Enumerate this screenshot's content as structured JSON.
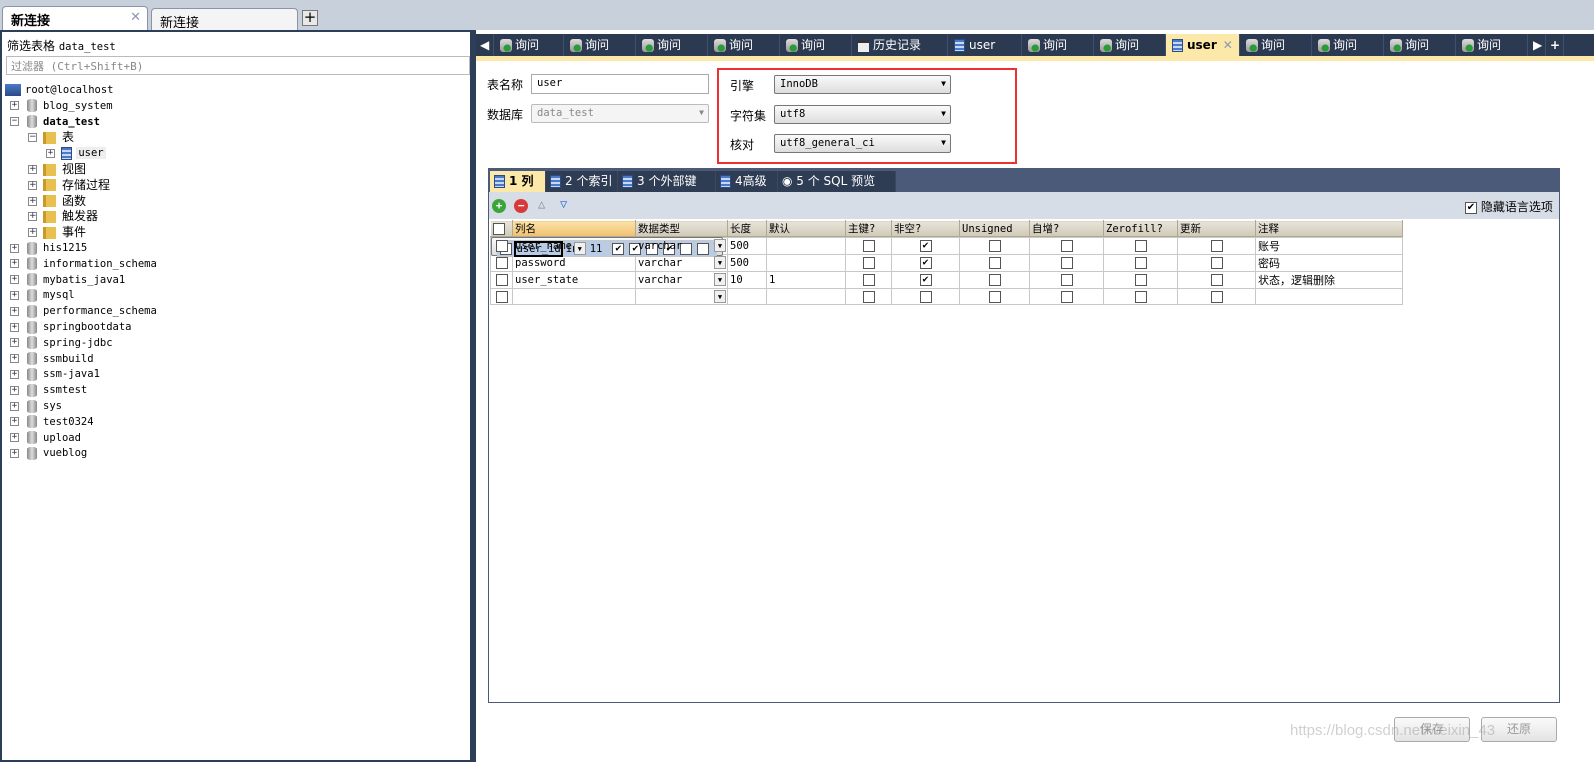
{
  "connection_tabs": [
    {
      "label": "新连接",
      "active": true
    },
    {
      "label": "新连接",
      "active": false
    }
  ],
  "left": {
    "filter_label": "筛选表格",
    "filter_db": "data_test",
    "filter_placeholder": "过滤器 (Ctrl+Shift+B)",
    "host": "root@localhost",
    "databases": [
      "blog_system",
      "data_test",
      "his1215",
      "information_schema",
      "mybatis_java1",
      "mysql",
      "performance_schema",
      "springbootdata",
      "spring-jdbc",
      "ssmbuild",
      "ssm-java1",
      "ssmtest",
      "sys",
      "test0324",
      "upload",
      "vueblog"
    ],
    "expanded_db": "data_test",
    "folders": [
      "表",
      "视图",
      "存储过程",
      "函数",
      "触发器",
      "事件"
    ],
    "table": "user"
  },
  "query_tabs": [
    {
      "label": "询问",
      "icon": "query-icon"
    },
    {
      "label": "询问",
      "icon": "query-icon"
    },
    {
      "label": "询问",
      "icon": "query-icon"
    },
    {
      "label": "询问",
      "icon": "query-icon"
    },
    {
      "label": "询问",
      "icon": "query-icon"
    },
    {
      "label": "历史记录",
      "icon": "history-icon"
    },
    {
      "label": "user",
      "icon": "table-icon"
    },
    {
      "label": "询问",
      "icon": "query-icon"
    },
    {
      "label": "询问",
      "icon": "query-icon"
    },
    {
      "label": "user",
      "icon": "table-icon",
      "active": true
    },
    {
      "label": "询问",
      "icon": "query-icon"
    },
    {
      "label": "询问",
      "icon": "query-icon"
    },
    {
      "label": "询问",
      "icon": "query-icon"
    },
    {
      "label": "询问",
      "icon": "query-icon"
    }
  ],
  "form": {
    "table_name_label": "表名称",
    "table_name": "user",
    "database_label": "数据库",
    "database": "data_test",
    "engine_label": "引擎",
    "engine": "InnoDB",
    "charset_label": "字符集",
    "charset": "utf8",
    "collation_label": "核对",
    "collation": "utf8_general_ci"
  },
  "inner_tabs": [
    "1 列",
    "2 个索引",
    "3 个外部键",
    "4高级",
    "5 个 SQL 预览"
  ],
  "hide_lang_options": "隐藏语言选项",
  "columns_header": [
    "列名",
    "数据类型",
    "长度",
    "默认",
    "主键?",
    "非空?",
    "Unsigned",
    "自增?",
    "Zerofill?",
    "更新",
    "注释"
  ],
  "rows": [
    {
      "name": "user_id",
      "type": "int",
      "length": "11",
      "default": "",
      "pk": true,
      "notnull": true,
      "unsigned": false,
      "ai": true,
      "zerofill": false,
      "update": false,
      "comment": ""
    },
    {
      "name": "user_name",
      "type": "varchar",
      "length": "500",
      "default": "",
      "pk": false,
      "notnull": true,
      "unsigned": false,
      "ai": false,
      "zerofill": false,
      "update": false,
      "comment": "账号"
    },
    {
      "name": "password",
      "type": "varchar",
      "length": "500",
      "default": "",
      "pk": false,
      "notnull": true,
      "unsigned": false,
      "ai": false,
      "zerofill": false,
      "update": false,
      "comment": "密码"
    },
    {
      "name": "user_state",
      "type": "varchar",
      "length": "10",
      "default": "1",
      "pk": false,
      "notnull": true,
      "unsigned": false,
      "ai": false,
      "zerofill": false,
      "update": false,
      "comment": "状态，逻辑删除"
    },
    {
      "name": "",
      "type": "",
      "length": "",
      "default": "",
      "pk": false,
      "notnull": false,
      "unsigned": false,
      "ai": false,
      "zerofill": false,
      "update": false,
      "comment": ""
    }
  ],
  "buttons": {
    "save": "保存",
    "revert": "还原"
  },
  "watermark": "https://blog.csdn.net/weixin_43"
}
